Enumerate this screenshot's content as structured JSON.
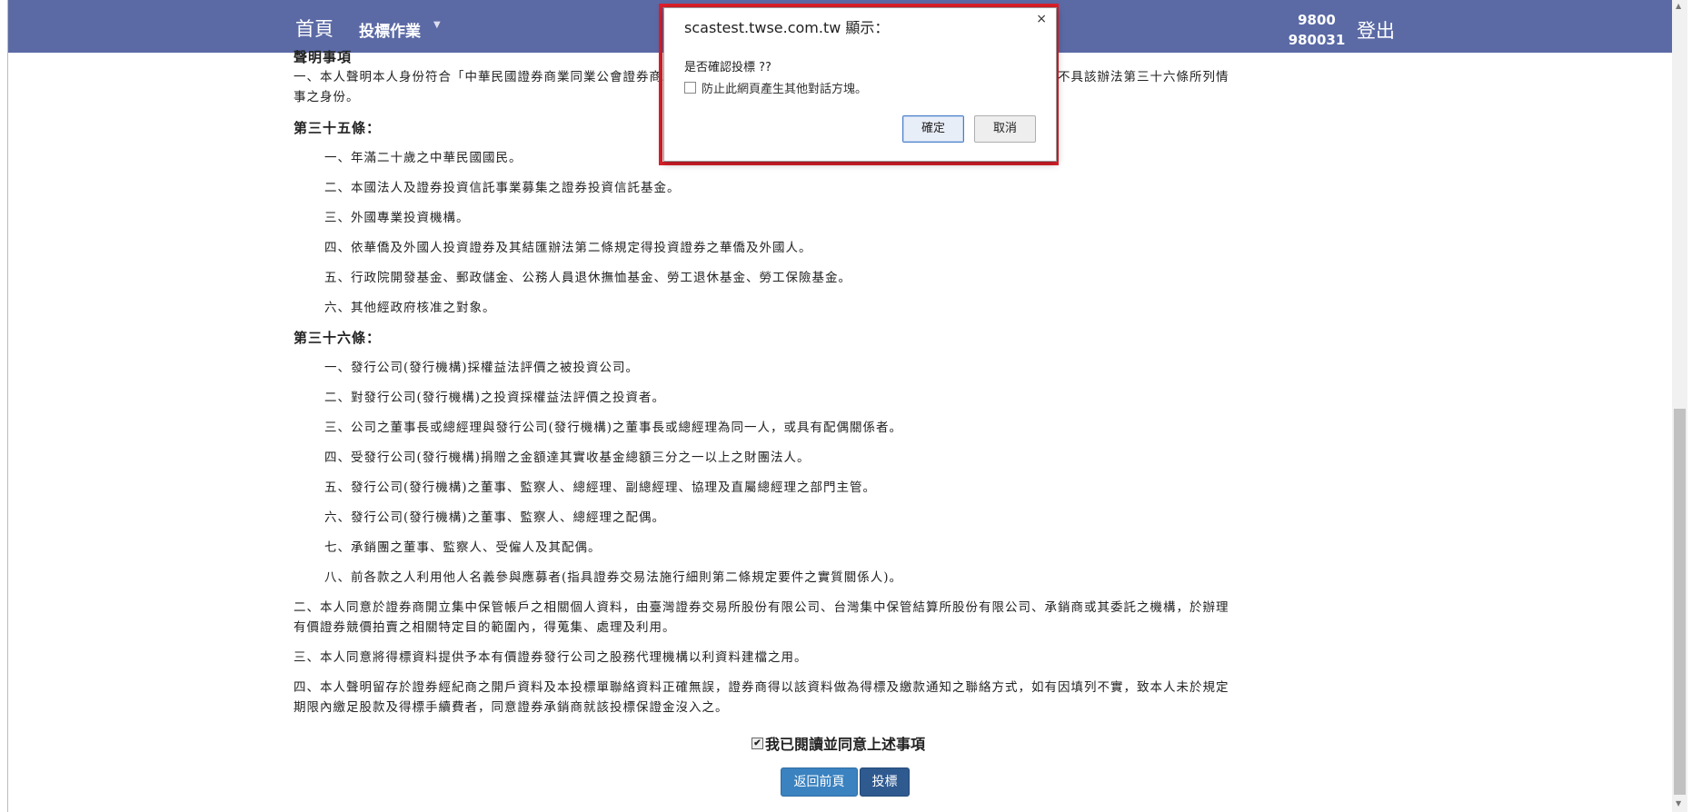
{
  "navbar": {
    "home": "首頁",
    "bidding_menu": "投標作業",
    "user_line1": "9800",
    "user_line2": "980031",
    "logout": "登出",
    "color": "#5b6aa5"
  },
  "content": {
    "title": "聲明事項",
    "p1_line1": "一、本人聲明本人身份符合「中華民國證券商業同業公會證券商承銷或再行銷售有價證券處理辦法」第三十五條所列之對象為限，且不具該辦法第三十六條所列情",
    "p1_line2": "事之身份。",
    "art35_heading": "第三十五條：",
    "art35_items": [
      "一、年滿二十歲之中華民國國民。",
      "二、本國法人及證券投資信託事業募集之證券投資信託基金。",
      "三、外國專業投資機構。",
      "四、依華僑及外國人投資證券及其結匯辦法第二條規定得投資證券之華僑及外國人。",
      "五、行政院開發基金、郵政儲金、公務人員退休撫恤基金、勞工退休基金、勞工保險基金。",
      "六、其他經政府核准之對象。"
    ],
    "art36_heading": "第三十六條：",
    "art36_items": [
      "一、發行公司(發行機構)採權益法評價之被投資公司。",
      "二、對發行公司(發行機構)之投資採權益法評價之投資者。",
      "三、公司之董事長或總經理與發行公司(發行機構)之董事長或總經理為同一人，或具有配偶關係者。",
      "四、受發行公司(發行機構)捐贈之金額達其實收基金總額三分之一以上之財團法人。",
      "五、發行公司(發行機構)之董事、監察人、總經理、副總經理、協理及直屬總經理之部門主管。",
      "六、發行公司(發行機構)之董事、監察人、總經理之配偶。",
      "七、承銷團之董事、監察人、受僱人及其配偶。",
      "八、前各款之人利用他人名義參與應募者(指具證券交易法施行細則第二條規定要件之實質關係人)。"
    ],
    "p2_line1": "二、本人同意於證券商開立集中保管帳戶之相關個人資料，由臺灣證券交易所股份有限公司、台灣集中保管結算所股份有限公司、承銷商或其委託之機構，於辦理",
    "p2_line2": "有價證券競價拍賣之相關特定目的範圍內，得蒐集、處理及利用。",
    "p3": "三、本人同意將得標資料提供予本有價證券發行公司之股務代理機構以利資料建檔之用。",
    "p4_line1": "四、本人聲明留存於證券經紀商之開戶資料及本投標單聯絡資料正確無誤，證券商得以該資料做為得標及繳款通知之聯絡方式，如有因填列不實，致本人未於規定",
    "p4_line2": "期限內繳足股款及得標手續費者，同意證券承銷商就該投標保證金沒入之。"
  },
  "agree": {
    "checked": true,
    "label": "我已閱讀並同意上述事項"
  },
  "buttons": {
    "back": "返回前頁",
    "bid": "投標"
  },
  "dialog": {
    "title": "scastest.twse.com.tw 顯示：",
    "close": "×",
    "message": "是否確認投標 ??",
    "option_label": "防止此網頁產生其他對話方塊。",
    "ok": "確定",
    "cancel": "取消",
    "highlight_color": "#e0202a"
  }
}
